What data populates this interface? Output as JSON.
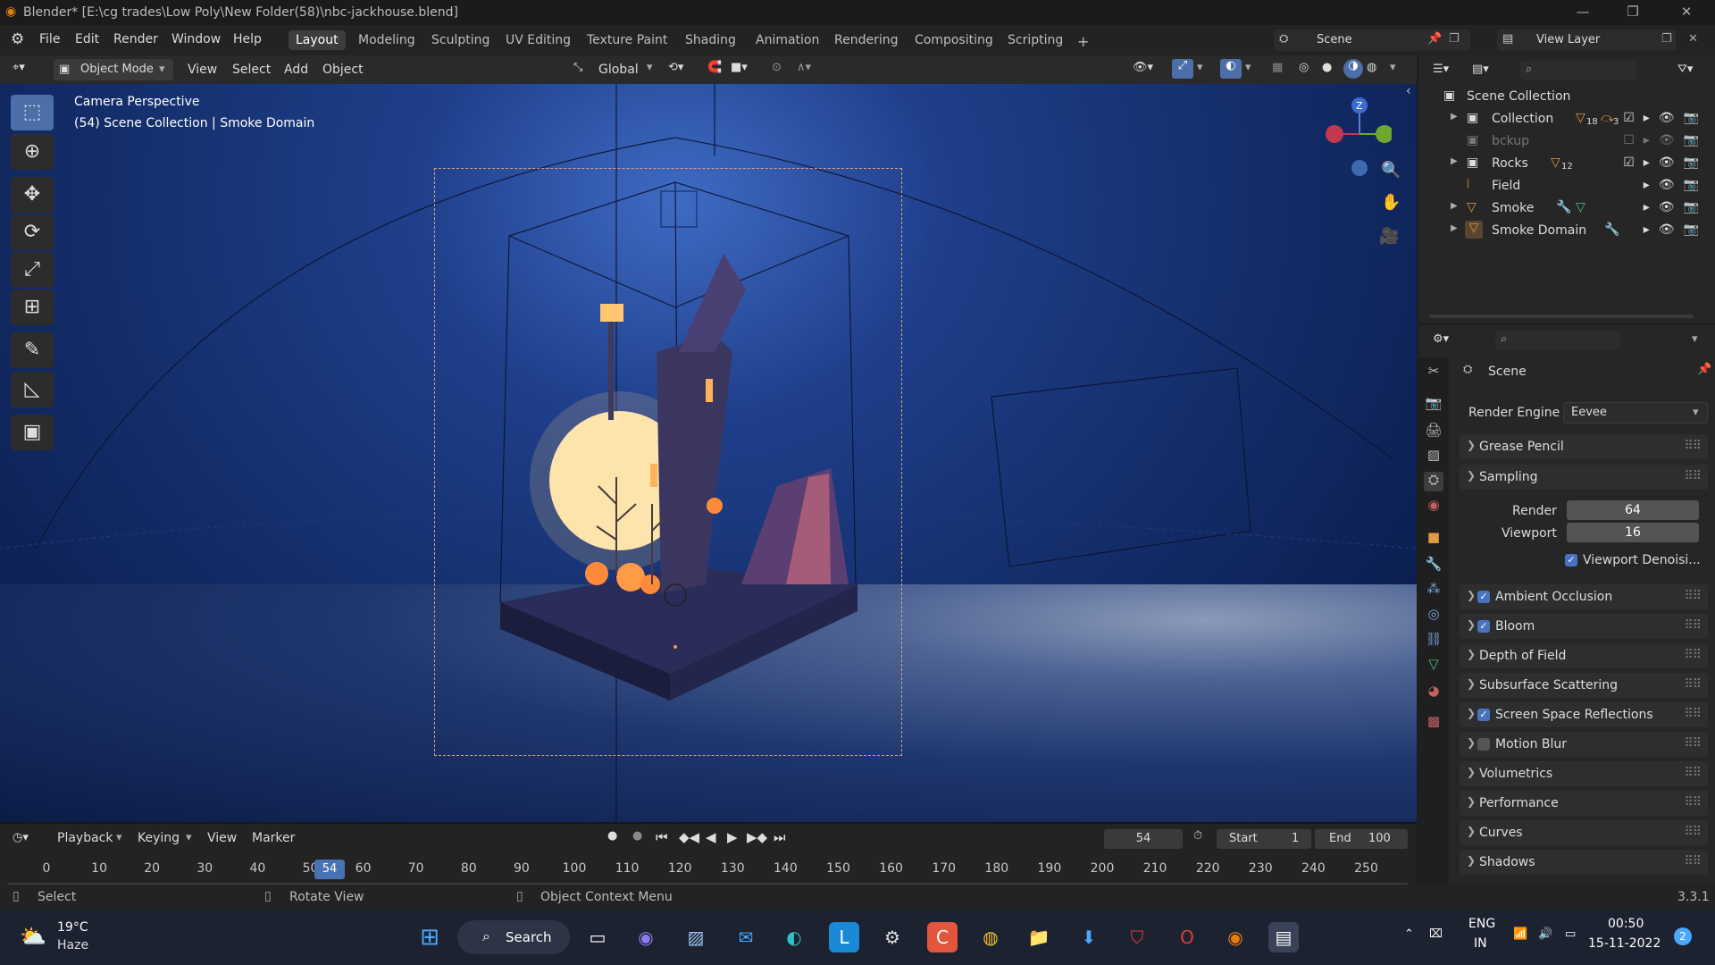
{
  "window": {
    "title": "Blender* [E:\\cg trades\\Low Poly\\New Folder(58)\\nbc-jackhouse.blend]",
    "controls": [
      "minimize-icon",
      "restore-icon",
      "close-icon"
    ]
  },
  "menubar": {
    "menus": [
      "File",
      "Edit",
      "Render",
      "Window",
      "Help"
    ],
    "workspaces": [
      "Layout",
      "Modeling",
      "Sculpting",
      "UV Editing",
      "Texture Paint",
      "Shading",
      "Animation",
      "Rendering",
      "Compositing",
      "Scripting"
    ],
    "active_workspace": "Layout",
    "add_workspace": "+",
    "scene": "Scene",
    "view_layer": "View Layer"
  },
  "viewport_header": {
    "mode": "Object Mode",
    "menus": [
      "View",
      "Select",
      "Add",
      "Object"
    ],
    "orientation": "Global"
  },
  "viewport": {
    "camera_label": "Camera Perspective",
    "context_label": "(54) Scene Collection | Smoke Domain"
  },
  "outliner": {
    "root": "Scene Collection",
    "items": [
      {
        "name": "Collection",
        "badge": "18",
        "badge2": "3",
        "checked": true
      },
      {
        "name": "bckup",
        "checked": false
      },
      {
        "name": "Rocks",
        "badge": "12",
        "checked": true
      },
      {
        "name": "Field"
      },
      {
        "name": "Smoke"
      },
      {
        "name": "Smoke Domain"
      }
    ]
  },
  "properties": {
    "context": "Scene",
    "render_engine_label": "Render Engine",
    "render_engine": "Eevee",
    "panels": {
      "grease_pencil": "Grease Pencil",
      "sampling": "Sampling",
      "render_label": "Render",
      "render_value": "64",
      "viewport_label": "Viewport",
      "viewport_value": "16",
      "viewport_denoise": "Viewport Denoisi...",
      "ambient_occlusion": "Ambient Occlusion",
      "bloom": "Bloom",
      "depth_of_field": "Depth of Field",
      "subsurface": "Subsurface Scattering",
      "ssr": "Screen Space Reflections",
      "motion_blur": "Motion Blur",
      "volumetrics": "Volumetrics",
      "performance": "Performance",
      "curves": "Curves",
      "shadows": "Shadows"
    }
  },
  "timeline": {
    "menus": [
      "Playback",
      "Keying",
      "View",
      "Marker"
    ],
    "current_frame": "54",
    "start_label": "Start",
    "start": "1",
    "end_label": "End",
    "end": "100",
    "ticks": [
      "0",
      "10",
      "20",
      "30",
      "40",
      "50",
      "60",
      "70",
      "80",
      "90",
      "100",
      "110",
      "120",
      "130",
      "140",
      "150",
      "160",
      "170",
      "180",
      "190",
      "200",
      "210",
      "220",
      "230",
      "240",
      "250"
    ],
    "cursor_frame": "54"
  },
  "statusbar": {
    "select": "Select",
    "rotate": "Rotate View",
    "context_menu": "Object Context Menu",
    "version": "3.3.1"
  },
  "taskbar": {
    "weather_temp": "19°C",
    "weather_desc": "Haze",
    "search": "Search",
    "lang": "ENG",
    "region": "IN",
    "time": "00:50",
    "date": "15-11-2022",
    "notif_count": "2"
  }
}
